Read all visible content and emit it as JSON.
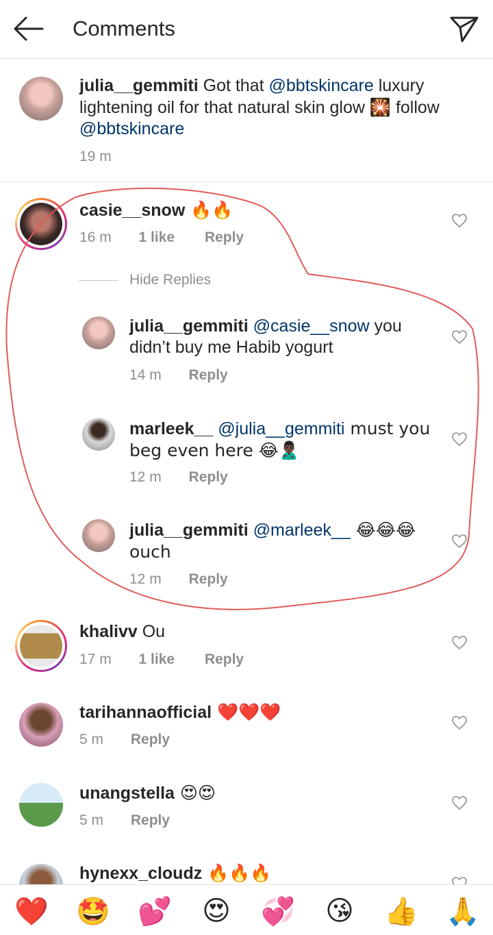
{
  "header": {
    "title": "Comments"
  },
  "caption": {
    "username": "julia__gemmiti",
    "text_1": " Got that ",
    "mention_1": "@bbtskincare",
    "text_2": " luxury lightening oil for that natural skin glow ",
    "emoji": "🎇",
    "text_3": " follow ",
    "mention_2": "@bbtskincare",
    "time": "19 m"
  },
  "comments": [
    {
      "username": "casie__snow",
      "text": " 🔥🔥",
      "time": "16 m",
      "likes": "1 like",
      "reply": "Reply"
    },
    {
      "username": "khalivv",
      "text": " Ou",
      "time": "17 m",
      "likes": "1 like",
      "reply": "Reply"
    },
    {
      "username": "tarihannaofficial",
      "text": " ❤️❤️❤️",
      "time": "5 m",
      "reply": "Reply"
    },
    {
      "username": "unangstella",
      "text": " 😍😍",
      "time": "5 m",
      "reply": "Reply"
    },
    {
      "username": "hynexx_cloudz",
      "text": " 🔥🔥🔥"
    }
  ],
  "hide_replies": "Hide Replies",
  "replies": [
    {
      "username": "julia__gemmiti",
      "mention": "@casie__snow",
      "text": " you didn’t buy me Habib yogurt",
      "time": "14 m",
      "reply": "Reply"
    },
    {
      "username": "marleek__",
      "mention": "@julia__gemmiti",
      "text": " must you beg even here 😂🙎🏿‍♂️",
      "time": "12 m",
      "reply": "Reply"
    },
    {
      "username": "julia__gemmiti",
      "mention": "@marleek__",
      "text": " 😂😂😂 ouch",
      "time": "12 m",
      "reply": "Reply"
    }
  ],
  "reactions": [
    "❤️",
    "🤩",
    "💕",
    "😍",
    "💞",
    "😘",
    "👍",
    "🙏"
  ],
  "colors": {
    "mention": "#003569",
    "meta": "#8e8e8e",
    "annotation": "#e05a5a"
  }
}
